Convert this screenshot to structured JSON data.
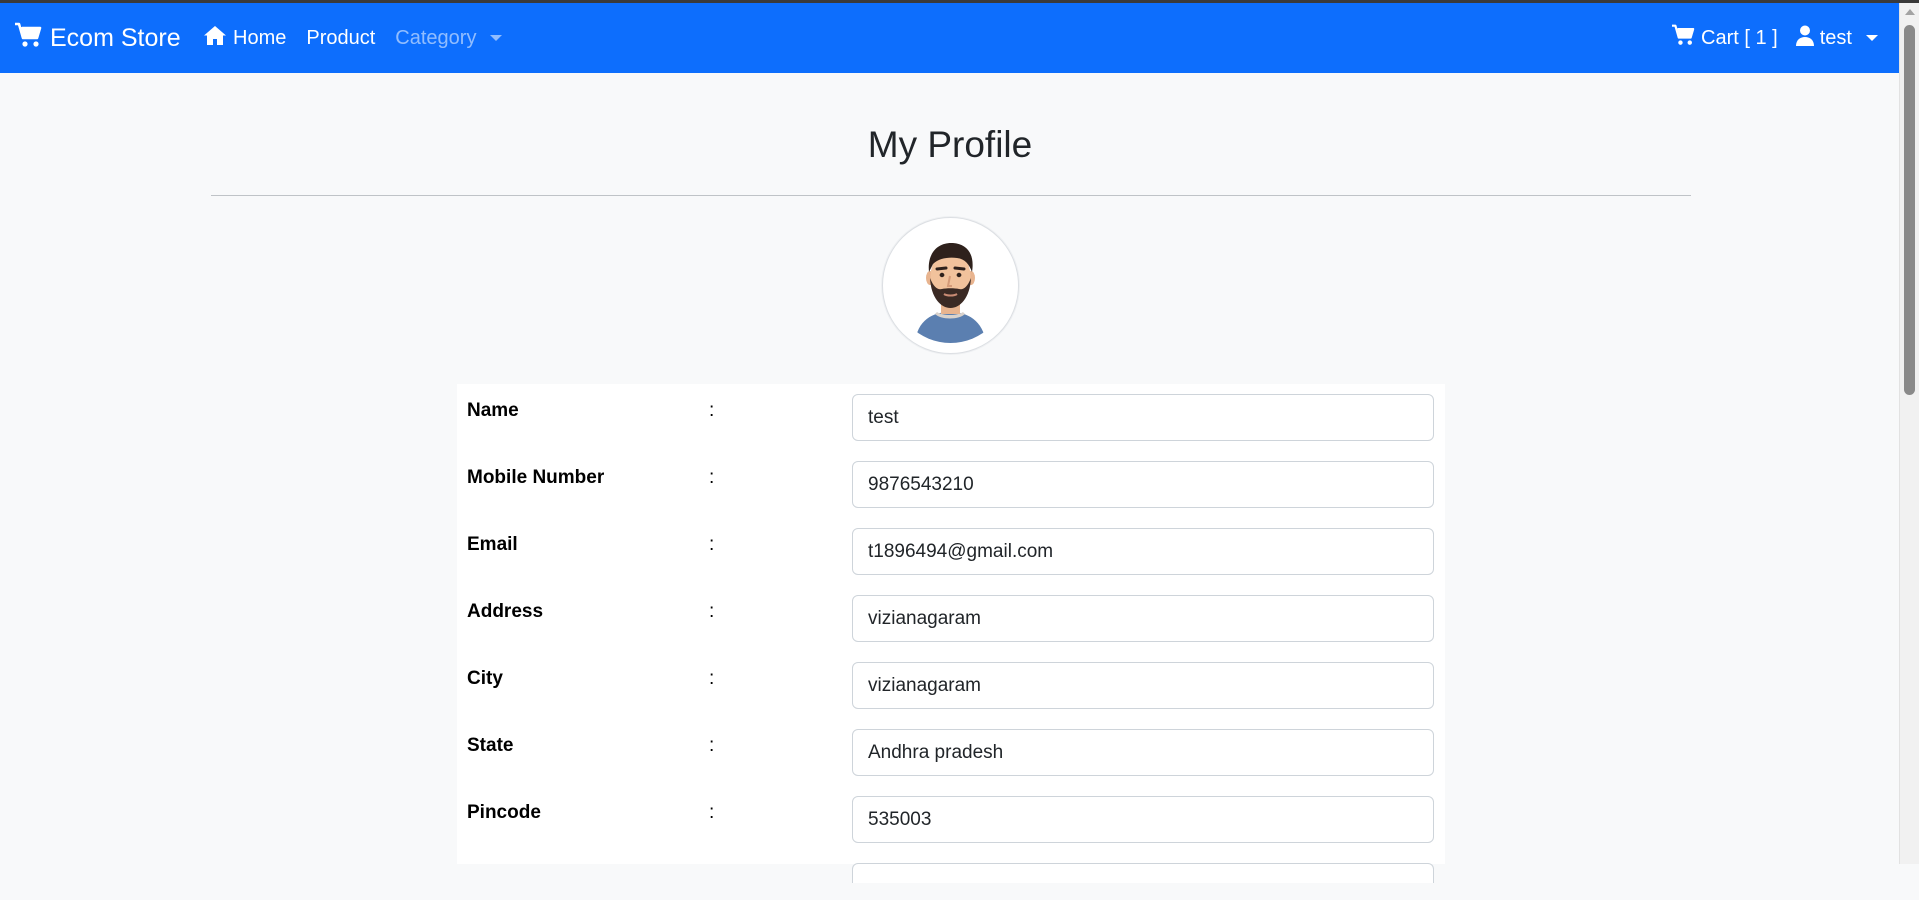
{
  "navbar": {
    "brand": "Ecom Store",
    "home": "Home",
    "product": "Product",
    "category": "Category",
    "cart": "Cart [ 1 ]",
    "user": "test",
    "color": "#0d6efd"
  },
  "page": {
    "title": "My Profile"
  },
  "profile": {
    "fields": [
      {
        "label": "Name",
        "colon": ":",
        "value": "test"
      },
      {
        "label": "Mobile Number",
        "colon": ":",
        "value": "9876543210"
      },
      {
        "label": "Email",
        "colon": ":",
        "value": "t1896494@gmail.com"
      },
      {
        "label": "Address",
        "colon": ":",
        "value": "vizianagaram"
      },
      {
        "label": "City",
        "colon": ":",
        "value": "vizianagaram"
      },
      {
        "label": "State",
        "colon": ":",
        "value": "Andhra pradesh"
      },
      {
        "label": "Pincode",
        "colon": ":",
        "value": "535003"
      }
    ]
  }
}
